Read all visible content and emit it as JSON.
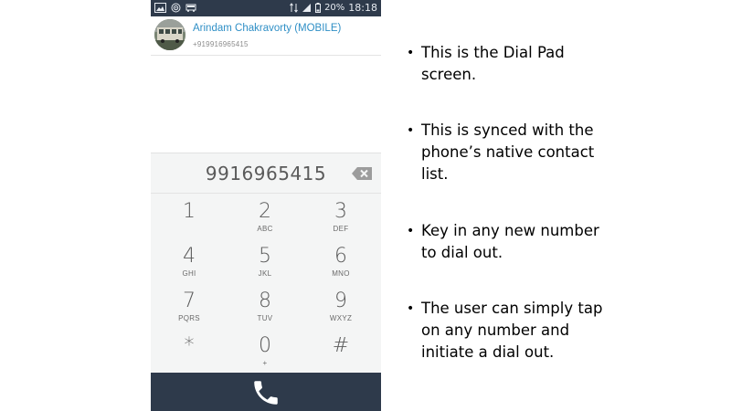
{
  "status_bar": {
    "battery": "20%",
    "time": "18:18",
    "icons_left": [
      "gallery-icon",
      "hotspot-icon",
      "car-icon"
    ],
    "icons_right": [
      "data-icon",
      "signal-icon",
      "battery-icon"
    ]
  },
  "contact": {
    "name": "Arindam Chakravorty (MOBILE)",
    "number": "+919916965415"
  },
  "dialpad": {
    "entered_number": "9916965415",
    "keys": [
      {
        "digit": "1",
        "letters": ""
      },
      {
        "digit": "2",
        "letters": "ABC"
      },
      {
        "digit": "3",
        "letters": "DEF"
      },
      {
        "digit": "4",
        "letters": "GHI"
      },
      {
        "digit": "5",
        "letters": "JKL"
      },
      {
        "digit": "6",
        "letters": "MNO"
      },
      {
        "digit": "7",
        "letters": "PQRS"
      },
      {
        "digit": "8",
        "letters": "TUV"
      },
      {
        "digit": "9",
        "letters": "WXYZ"
      },
      {
        "digit": "*",
        "letters": ""
      },
      {
        "digit": "0",
        "letters": "+"
      },
      {
        "digit": "#",
        "letters": ""
      }
    ]
  },
  "notes": [
    {
      "bullet": "•",
      "text": "This is the Dial Pad screen."
    },
    {
      "bullet": "•",
      "text": "This is synced with the phone’s native contact list."
    },
    {
      "bullet": "•",
      "text": "Key in any new number to dial out."
    },
    {
      "bullet": "•",
      "text": "The user can simply tap on any number and initiate a dial out."
    }
  ],
  "colors": {
    "bar_background": "#2e3a4b",
    "contact_name": "#2f8fc6",
    "dialpad_background": "#f4f5f5"
  }
}
